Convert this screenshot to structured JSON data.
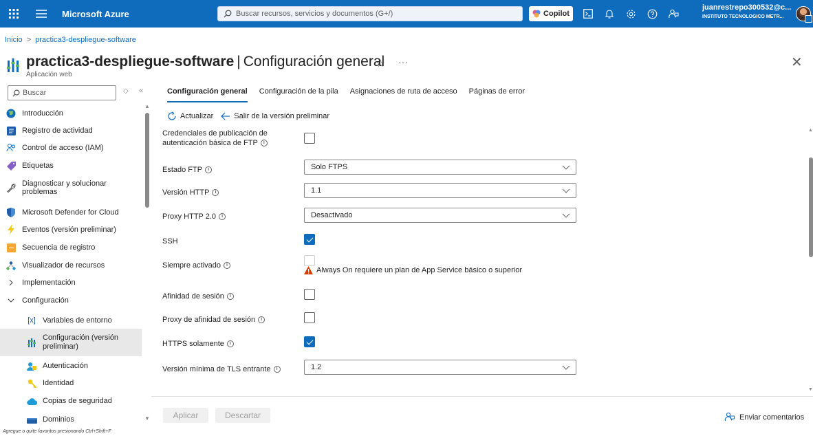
{
  "topbar": {
    "brand": "Microsoft Azure",
    "search_placeholder": "Buscar recursos, servicios y documentos (G+/)",
    "copilot_label": "Copilot",
    "user_email": "juanrestrepo300532@c...",
    "user_org": "INSTITUTO TECNOLOGICO METR..."
  },
  "breadcrumb": {
    "home": "Inicio",
    "current": "practica3-despliegue-software"
  },
  "header": {
    "resource_name": "practica3-despliegue-software",
    "separator": "|",
    "page_name": "Configuración general",
    "subtitle": "Aplicación web"
  },
  "sidebar": {
    "search_placeholder": "Buscar",
    "items": [
      {
        "label": "Introducción",
        "icon": "globe-icon"
      },
      {
        "label": "Registro de actividad",
        "icon": "activity-log-icon"
      },
      {
        "label": "Control de acceso (IAM)",
        "icon": "people-icon"
      },
      {
        "label": "Etiquetas",
        "icon": "tag-icon"
      },
      {
        "label": "Diagnosticar y solucionar problemas",
        "icon": "wrench-icon"
      },
      {
        "label": "Microsoft Defender for Cloud",
        "icon": "shield-icon"
      },
      {
        "label": "Eventos (versión preliminar)",
        "icon": "bolt-icon"
      },
      {
        "label": "Secuencia de registro",
        "icon": "log-stream-icon"
      },
      {
        "label": "Visualizador de recursos",
        "icon": "resource-visualizer-icon"
      },
      {
        "label": "Implementación",
        "icon": "chevron-right-icon"
      },
      {
        "label": "Configuración",
        "icon": "chevron-down-icon"
      },
      {
        "label": "Variables de entorno",
        "icon": "variable-icon"
      },
      {
        "label": "Configuración (versión preliminar)",
        "icon": "config-icon"
      },
      {
        "label": "Autenticación",
        "icon": "auth-icon"
      },
      {
        "label": "Identidad",
        "icon": "key-icon"
      },
      {
        "label": "Copias de seguridad",
        "icon": "cloud-icon"
      },
      {
        "label": "Dominios",
        "icon": "domain-icon"
      }
    ],
    "favorites_hint": "Agregue o quite favoritos presionando Ctrl+Shift+F"
  },
  "tabs": [
    {
      "label": "Configuración general",
      "active": true
    },
    {
      "label": "Configuración de la pila",
      "active": false
    },
    {
      "label": "Asignaciones de ruta de acceso",
      "active": false
    },
    {
      "label": "Páginas de error",
      "active": false
    }
  ],
  "toolbar": {
    "refresh_label": "Actualizar",
    "exit_preview_label": "Salir de la versión preliminar"
  },
  "settings": {
    "ftp_credentials_label_1": "Credenciales de publicación de",
    "ftp_credentials_label_2": "autenticación básica de FTP",
    "ftp_state_label": "Estado FTP",
    "ftp_state_value": "Solo FTPS",
    "http_version_label": "Versión HTTP",
    "http_version_value": "1.1",
    "http2_proxy_label": "Proxy HTTP 2.0",
    "http2_proxy_value": "Desactivado",
    "ssh_label": "SSH",
    "always_on_label": "Siempre activado",
    "always_on_warning": "Always On requiere un plan de App Service básico o superior",
    "session_affinity_label": "Afinidad de sesión",
    "session_affinity_proxy_label": "Proxy de afinidad de sesión",
    "https_only_label": "HTTPS solamente",
    "min_tls_label": "Versión mínima de TLS entrante",
    "min_tls_value": "1.2"
  },
  "footer": {
    "apply_label": "Aplicar",
    "discard_label": "Descartar",
    "feedback_label": "Enviar comentarios"
  },
  "colors": {
    "accent": "#0f6cbd",
    "warning": "#d83b01"
  }
}
